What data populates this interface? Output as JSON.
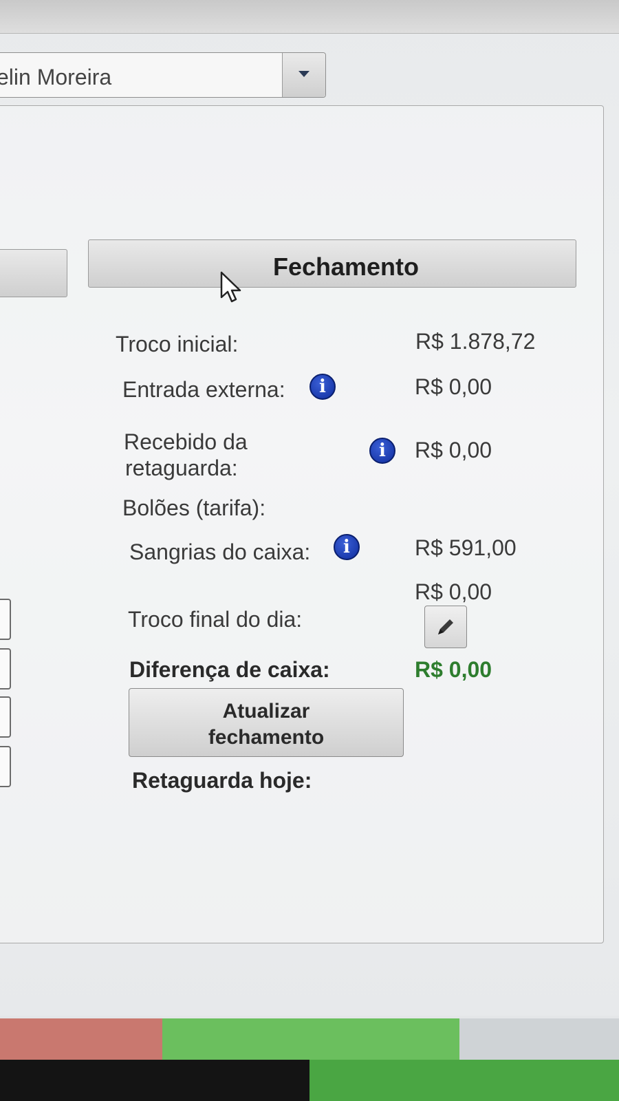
{
  "user_select": {
    "value": "elin Moreira"
  },
  "tabs": {
    "fechamento_label": "Fechamento"
  },
  "summary": {
    "troco_inicial": {
      "label": "Troco inicial:",
      "value": "R$ 1.878,72"
    },
    "entrada_externa": {
      "label": "Entrada externa:",
      "value": "R$ 0,00"
    },
    "recebido_retaguarda": {
      "label_line1": "Recebido da",
      "label_line2": "retaguarda:",
      "value": "R$ 0,00"
    },
    "boloes": {
      "label": "Bolões (tarifa):"
    },
    "sangrias": {
      "label": "Sangrias do caixa:",
      "value": "R$ 591,00"
    },
    "troco_final": {
      "label": "Troco final do dia:",
      "value": "R$ 0,00"
    },
    "diferenca": {
      "label": "Diferença de caixa:",
      "value": "R$ 0,00"
    },
    "retaguarda_hoje": {
      "label": "Retaguarda hoje:"
    }
  },
  "buttons": {
    "update_line1": "Atualizar",
    "update_line2": "fechamento"
  },
  "icons": {
    "info": "info-icon",
    "edit": "pencil-icon",
    "dropdown": "chevron-down-icon",
    "cursor": "mouse-pointer-icon"
  },
  "colors": {
    "info_blue": "#1a3fbf",
    "diferenca_green": "#2e7d2e"
  }
}
